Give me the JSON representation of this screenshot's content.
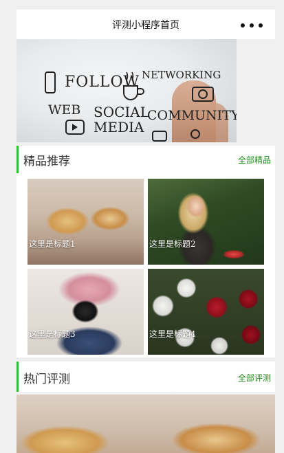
{
  "navbar": {
    "title": "评测小程序首页",
    "more_icon": "more-dots-icon"
  },
  "banner": {
    "words": [
      "FOLLOW",
      "NETWORKING",
      "WEB",
      "SOCIAL",
      "MEDIA",
      "COMMUNITY"
    ],
    "slide_count": 2,
    "active_slide": 2
  },
  "featured": {
    "title": "精品推荐",
    "link": "全部精品",
    "items": [
      {
        "caption": "这里是标题1"
      },
      {
        "caption": "这里是标题2"
      },
      {
        "caption": "这里是标题3"
      },
      {
        "caption": "这里是标题4"
      }
    ]
  },
  "hot": {
    "title": "热门评测",
    "link": "全部评测"
  },
  "colors": {
    "accent": "#2dbf2d",
    "link": "#1a8a1a"
  }
}
